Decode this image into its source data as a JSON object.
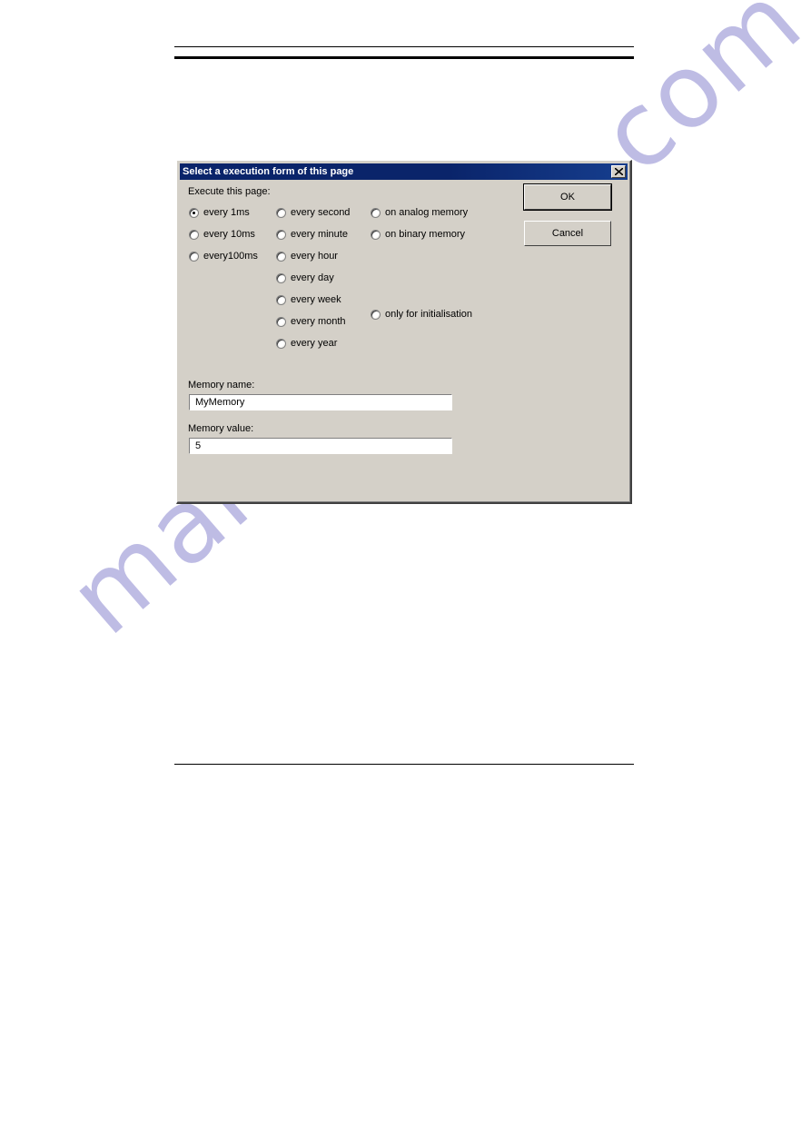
{
  "document": {
    "watermark": "manualshive.com",
    "rules": {
      "top_thin": true,
      "top_thick": true,
      "bottom": true
    }
  },
  "dialog": {
    "title": "Select a execution form of this page",
    "close_icon": "close-icon",
    "group_label": "Execute this page:",
    "radio_columns": [
      {
        "name": "interval-fast",
        "options": [
          {
            "label": "every 1ms",
            "checked": true
          },
          {
            "label": "every 10ms",
            "checked": false
          },
          {
            "label": "every100ms",
            "checked": false
          }
        ]
      },
      {
        "name": "interval-slow",
        "options": [
          {
            "label": "every second",
            "checked": false
          },
          {
            "label": "every minute",
            "checked": false
          },
          {
            "label": "every hour",
            "checked": false
          },
          {
            "label": "every day",
            "checked": false
          },
          {
            "label": "every week",
            "checked": false
          },
          {
            "label": "every month",
            "checked": false
          },
          {
            "label": "every year",
            "checked": false
          }
        ]
      },
      {
        "name": "memory-trigger",
        "options": [
          {
            "label": "on analog memory",
            "checked": false
          },
          {
            "label": "on binary memory",
            "checked": false
          }
        ]
      },
      {
        "name": "init-trigger",
        "options": [
          {
            "label": "only for initialisation",
            "checked": false
          }
        ]
      }
    ],
    "fields": [
      {
        "label": "Memory name:",
        "value": "MyMemory",
        "placeholder": ""
      },
      {
        "label": "Memory value:",
        "value": "5",
        "placeholder": ""
      }
    ],
    "buttons": {
      "ok": "OK",
      "cancel": "Cancel"
    }
  },
  "colors": {
    "dialog_face": "#d4d0c8",
    "titlebar_start": "#0a246a",
    "titlebar_end": "#163e8e",
    "titlebar_text": "#ffffff",
    "field_bg": "#ffffff",
    "text": "#000000",
    "watermark": "#b3b1e0",
    "rule": "#000000"
  }
}
